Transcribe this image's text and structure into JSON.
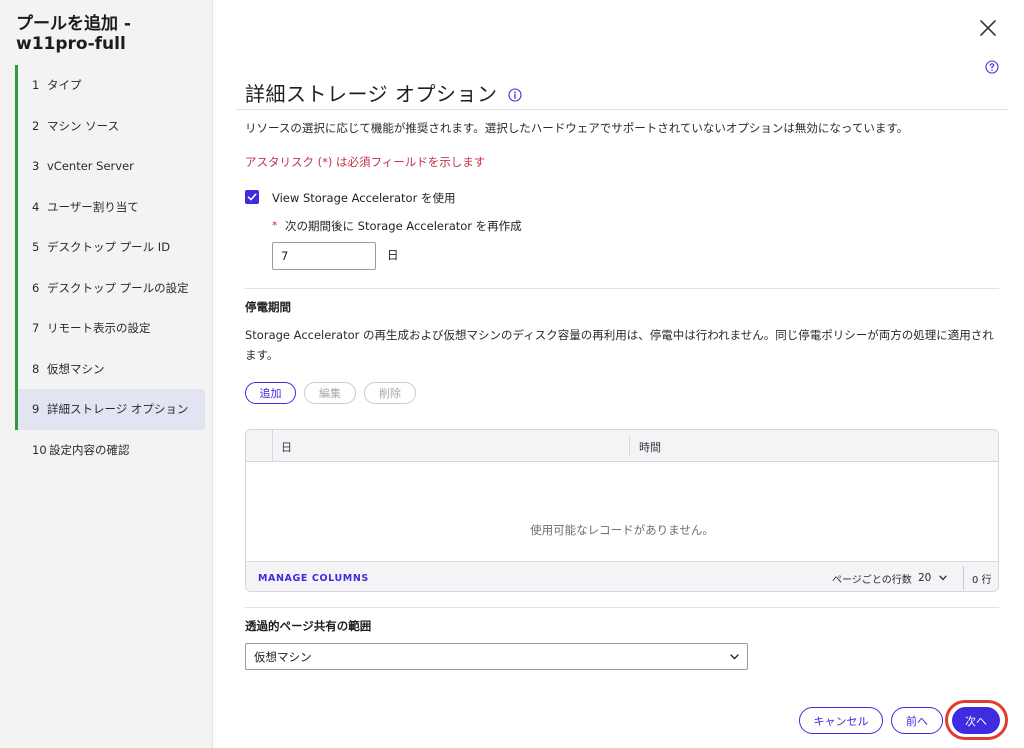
{
  "sidebar": {
    "title": "プールを追加 - w11pro-full",
    "steps": [
      {
        "num": "1",
        "label": "タイプ"
      },
      {
        "num": "2",
        "label": "マシン ソース"
      },
      {
        "num": "3",
        "label": "vCenter Server"
      },
      {
        "num": "4",
        "label": "ユーザー割り当て"
      },
      {
        "num": "5",
        "label": "デスクトップ プール ID"
      },
      {
        "num": "6",
        "label": "デスクトップ プールの設定"
      },
      {
        "num": "7",
        "label": "リモート表示の設定"
      },
      {
        "num": "8",
        "label": "仮想マシン"
      },
      {
        "num": "9",
        "label": "詳細ストレージ オプション"
      },
      {
        "num": "10",
        "label": "設定内容の確認"
      }
    ]
  },
  "main": {
    "title": "詳細ストレージ オプション",
    "description": "リソースの選択に応じて機能が推奨されます。選択したハードウェアでサポートされていないオプションは無効になっています。",
    "required_note": "アスタリスク (*) は必須フィールドを示します",
    "storage_accelerator": {
      "checkbox_label": "View Storage Accelerator を使用",
      "checked": true,
      "regenerate_label": "次の期間後に Storage Accelerator を再作成",
      "required_star": "*",
      "days_value": "7",
      "days_unit": "日"
    },
    "blackout": {
      "heading": "停電期間",
      "description": "Storage Accelerator の再生成および仮想マシンのディスク容量の再利用は、停電中は行われません。同じ停電ポリシーが両方の処理に適用されます。",
      "add_label": "追加",
      "edit_label": "編集",
      "delete_label": "削除",
      "grid": {
        "columns": [
          "日",
          "時間"
        ],
        "empty_message": "使用可能なレコードがありません。",
        "manage_columns": "MANAGE COLUMNS",
        "rows_per_page_label": "ページごとの行数",
        "rows_per_page": "20",
        "row_count": "0 行"
      }
    },
    "transparent_page_sharing": {
      "heading": "透過的ページ共有の範囲",
      "selected": "仮想マシン"
    }
  },
  "footer": {
    "cancel_label": "キャンセル",
    "back_label": "前へ",
    "next_label": "次へ"
  },
  "colors": {
    "accent": "#3d2ce0",
    "completed_step": "#2e9a44",
    "required": "#c4314b",
    "highlight": "#e13d2f"
  }
}
